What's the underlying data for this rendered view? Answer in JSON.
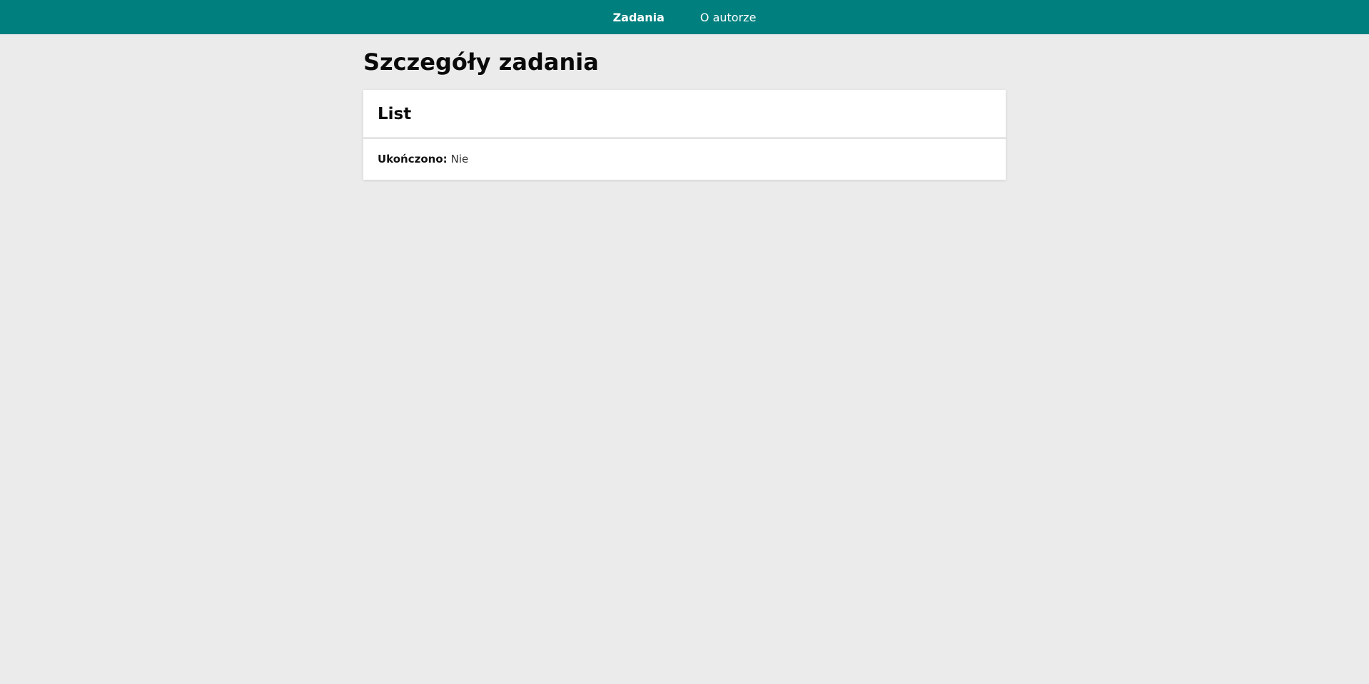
{
  "nav": {
    "items": [
      {
        "label": "Zadania",
        "active": true
      },
      {
        "label": "O autorze",
        "active": false
      }
    ]
  },
  "page": {
    "title": "Szczegóły zadania"
  },
  "task": {
    "name": "List",
    "completed_label": "Ukończono:",
    "completed_value": "Nie"
  },
  "colors": {
    "nav_background": "#007f7f",
    "page_background": "#ebebeb",
    "card_background": "#ffffff"
  }
}
